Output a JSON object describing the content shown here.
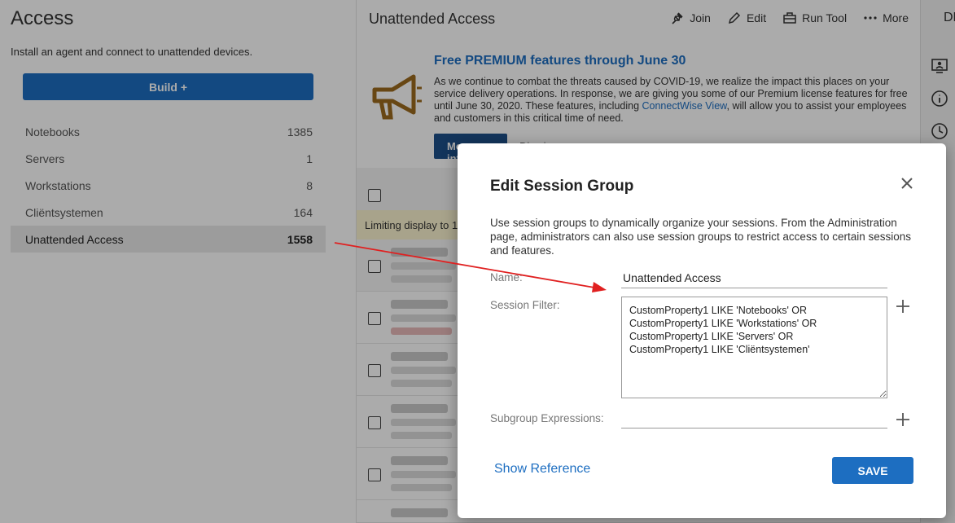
{
  "left": {
    "title": "Access",
    "subtitle": "Install an agent and connect to unattended devices.",
    "build_label": "Build +",
    "groups": [
      {
        "label": "Notebooks",
        "count": "1385"
      },
      {
        "label": "Servers",
        "count": "1"
      },
      {
        "label": "Workstations",
        "count": "8"
      },
      {
        "label": "Cliëntsystemen",
        "count": "164"
      },
      {
        "label": "Unattended Access",
        "count": "1558"
      }
    ]
  },
  "main": {
    "title": "Unattended Access",
    "toolbar": {
      "join": "Join",
      "edit": "Edit",
      "run_tool": "Run Tool",
      "more": "More"
    },
    "promo": {
      "heading": "Free PREMIUM features through June 30",
      "body_1": "As we continue to combat the threats caused by COVID-19, we realize the impact this places on your service delivery operations. In response, we are giving you some of our Premium license features for free until June 30, 2020. These features, including ",
      "link": "ConnectWise View",
      "body_2": ", will allow you to assist your employees and customers in this critical time of need.",
      "button_label": "More info",
      "dismiss_label": "Dismiss"
    },
    "limit_text": "Limiting display to 1"
  },
  "rail": {
    "label": "DE"
  },
  "dialog": {
    "title": "Edit Session Group",
    "description": "Use session groups to dynamically organize your sessions. From the Administration page, administrators can also use session groups to restrict access to certain sessions and features.",
    "name_label": "Name:",
    "name_value": "Unattended Access",
    "filter_label": "Session Filter:",
    "filter_value": "CustomProperty1 LIKE 'Notebooks' OR\nCustomProperty1 LIKE 'Workstations' OR\nCustomProperty1 LIKE 'Servers' OR\nCustomProperty1 LIKE 'Cliëntsystemen'",
    "subgroup_label": "Subgroup Expressions:",
    "subgroup_value": "",
    "show_reference": "Show Reference",
    "save_label": "SAVE"
  },
  "colors": {
    "accent": "#1d6ec1",
    "annotation": "#e02020",
    "promo_icon": "#9c6a1e"
  }
}
